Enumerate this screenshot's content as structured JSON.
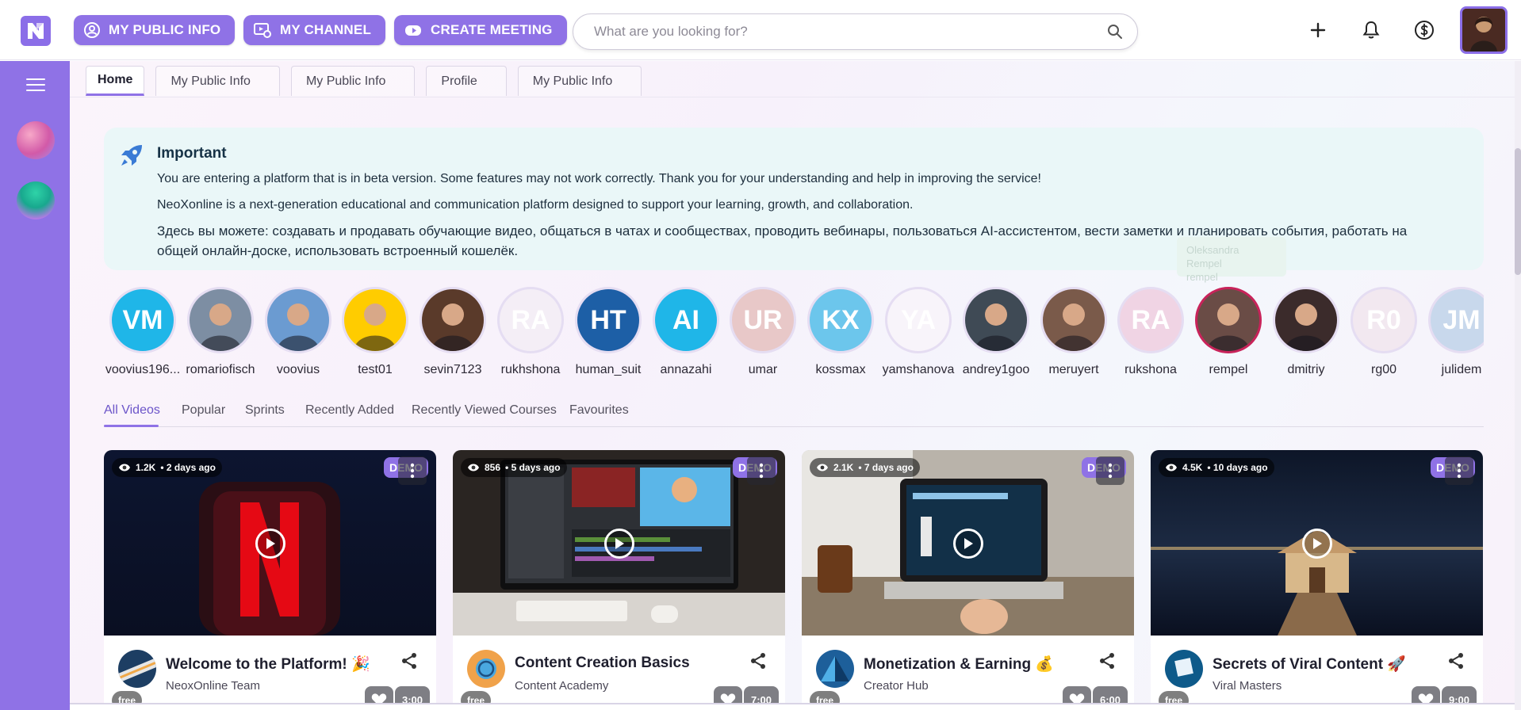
{
  "topbar": {
    "buttons": [
      {
        "label": "MY PUBLIC INFO",
        "icon": "user-circle-icon"
      },
      {
        "label": "MY CHANNEL",
        "icon": "video-channel-icon"
      },
      {
        "label": "CREATE MEETING",
        "icon": "camera-meeting-icon"
      }
    ],
    "search_placeholder": "What are you looking for?"
  },
  "tabs": [
    {
      "label": "Home",
      "active": true
    },
    {
      "label": "My Public Info"
    },
    {
      "label": "My Public Info"
    },
    {
      "label": "Profile"
    },
    {
      "label": "My Public Info"
    }
  ],
  "notice": {
    "title": "Important",
    "line1": "You are entering a platform that is in beta version. Some features may not work correctly. Thank you for your understanding and help in improving the service!",
    "line2": "NeoXonline is a next-generation educational and communication platform designed to support your learning, growth, and collaboration.",
    "line3": "Здесь вы можете: создавать и продавать обучающие видео, общаться в чатах и сообществах, проводить вебинары, пользоваться AI-ассистентом, вести заметки и планировать события, работать на общей онлайн-доске, использовать встроенный кошелёк."
  },
  "tooltip": {
    "line1": "Oleksandra Rempel",
    "line2": "rempel"
  },
  "creators": [
    {
      "initials": "VM",
      "name": "voovius196...",
      "color": "#1fb6e8"
    },
    {
      "initials": "",
      "name": "romariofisch",
      "color": "#7d8ea3"
    },
    {
      "initials": "",
      "name": "voovius",
      "color": "#6b9bd1"
    },
    {
      "initials": "",
      "name": "test01",
      "color": "#ffcc00"
    },
    {
      "initials": "",
      "name": "sevin7123",
      "color": "#5a3a2a"
    },
    {
      "initials": "RA",
      "name": "rukhshona",
      "color": "#f4eef6"
    },
    {
      "initials": "HT",
      "name": "human_suit",
      "color": "#1d5fa6"
    },
    {
      "initials": "AI",
      "name": "annazahi",
      "color": "#1fb6e8"
    },
    {
      "initials": "UR",
      "name": "umar",
      "color": "#e8c8c8"
    },
    {
      "initials": "KX",
      "name": "kossmax",
      "color": "#6cc6ec"
    },
    {
      "initials": "YA",
      "name": "yamshanova",
      "color": "#f8f4fa"
    },
    {
      "initials": "",
      "name": "andrey1goo",
      "color": "#3f4a55"
    },
    {
      "initials": "",
      "name": "meruyert",
      "color": "#7a5a4a"
    },
    {
      "initials": "RA",
      "name": "rukshona",
      "color": "#f0d4e4"
    },
    {
      "initials": "",
      "name": "rempel",
      "color": "#6a4c46"
    },
    {
      "initials": "",
      "name": "dmitriy",
      "color": "#3b2b2b"
    },
    {
      "initials": "R0",
      "name": "rg00",
      "color": "#f2e8f0"
    },
    {
      "initials": "JM",
      "name": "julidem",
      "color": "#c8d8ec"
    }
  ],
  "filters": [
    "All Videos",
    "Popular",
    "Sprints",
    "Recently Added",
    "Recently Viewed Courses",
    "Favourites"
  ],
  "videos": [
    {
      "views": "1.2K",
      "age": "• 2 days ago",
      "badge": "DEMO",
      "price": "free",
      "duration": "3:00",
      "title": "Welcome to the Platform! 🎉",
      "author": "NeoxOnline Team"
    },
    {
      "views": "856",
      "age": "• 5 days ago",
      "badge": "DEMO",
      "price": "free",
      "duration": "7:00",
      "title": "Content Creation Basics",
      "author": "Content Academy"
    },
    {
      "views": "2.1K",
      "age": "• 7 days ago",
      "badge": "DEMO",
      "price": "free",
      "duration": "6:00",
      "title": "Monetization & Earning 💰",
      "author": "Creator Hub"
    },
    {
      "views": "4.5K",
      "age": "• 10 days ago",
      "badge": "DEMO",
      "price": "free",
      "duration": "9:00",
      "title": "Secrets of Viral Content 🚀",
      "author": "Viral Masters"
    }
  ],
  "colors": {
    "accent": "#8f72e6",
    "notice_bg": "#eaf7f8"
  }
}
